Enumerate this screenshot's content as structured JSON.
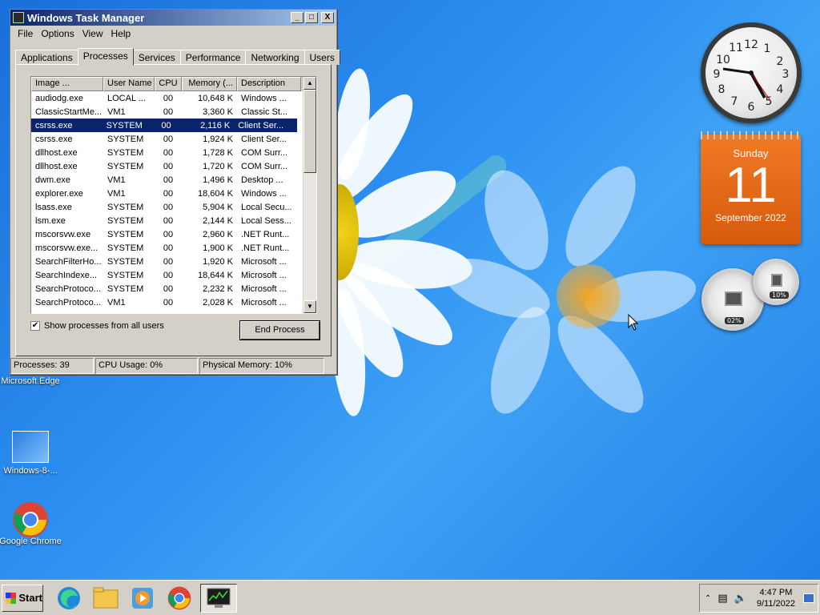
{
  "window": {
    "title": "Windows Task Manager",
    "buttons": {
      "minimize": "_",
      "maximize": "□",
      "close": "X"
    },
    "menu": [
      "File",
      "Options",
      "View",
      "Help"
    ],
    "tabs": [
      "Applications",
      "Processes",
      "Services",
      "Performance",
      "Networking",
      "Users"
    ],
    "active_tab": "Processes",
    "columns": [
      "Image ...",
      "User Name",
      "CPU",
      "Memory (...",
      "Description"
    ],
    "rows": [
      [
        "audiodg.exe",
        "LOCAL ...",
        "00",
        "10,648 K",
        "Windows ..."
      ],
      [
        "ClassicStartMe...",
        "VM1",
        "00",
        "3,360 K",
        "Classic St..."
      ],
      [
        "csrss.exe",
        "SYSTEM",
        "00",
        "2,116 K",
        "Client Ser..."
      ],
      [
        "csrss.exe",
        "SYSTEM",
        "00",
        "1,924 K",
        "Client Ser..."
      ],
      [
        "dllhost.exe",
        "SYSTEM",
        "00",
        "1,728 K",
        "COM Surr..."
      ],
      [
        "dllhost.exe",
        "SYSTEM",
        "00",
        "1,720 K",
        "COM Surr..."
      ],
      [
        "dwm.exe",
        "VM1",
        "00",
        "1,496 K",
        "Desktop ..."
      ],
      [
        "explorer.exe",
        "VM1",
        "00",
        "18,604 K",
        "Windows ..."
      ],
      [
        "lsass.exe",
        "SYSTEM",
        "00",
        "5,904 K",
        "Local Secu..."
      ],
      [
        "lsm.exe",
        "SYSTEM",
        "00",
        "2,144 K",
        "Local Sess..."
      ],
      [
        "mscorsvw.exe",
        "SYSTEM",
        "00",
        "2,960 K",
        ".NET Runt..."
      ],
      [
        "mscorsvw.exe...",
        "SYSTEM",
        "00",
        "1,900 K",
        ".NET Runt..."
      ],
      [
        "SearchFilterHo...",
        "SYSTEM",
        "00",
        "1,920 K",
        "Microsoft ..."
      ],
      [
        "SearchIndexe...",
        "SYSTEM",
        "00",
        "18,644 K",
        "Microsoft ..."
      ],
      [
        "SearchProtoco...",
        "SYSTEM",
        "00",
        "2,232 K",
        "Microsoft ..."
      ],
      [
        "SearchProtoco...",
        "VM1",
        "00",
        "2,028 K",
        "Microsoft ..."
      ]
    ],
    "selected_row": 2,
    "show_all_label": "Show processes from all users",
    "end_process_label": "End Process",
    "status": {
      "processes": "Processes: 39",
      "cpu": "CPU Usage: 0%",
      "memory": "Physical Memory: 10%"
    }
  },
  "desktop_icons": [
    {
      "label": "Microsoft Edge"
    },
    {
      "label": "Windows-8-..."
    },
    {
      "label": "Google Chrome"
    }
  ],
  "gadgets": {
    "calendar": {
      "day_of_week": "Sunday",
      "day": "11",
      "month_year": "September 2022"
    },
    "meter": {
      "cpu": "02%",
      "memory": "10%"
    },
    "clock_numbers": [
      "12",
      "1",
      "2",
      "3",
      "4",
      "5",
      "6",
      "7",
      "8",
      "9",
      "10",
      "11"
    ]
  },
  "taskbar": {
    "start_label": "Start",
    "time": "4:47 PM",
    "date": "9/11/2022"
  }
}
